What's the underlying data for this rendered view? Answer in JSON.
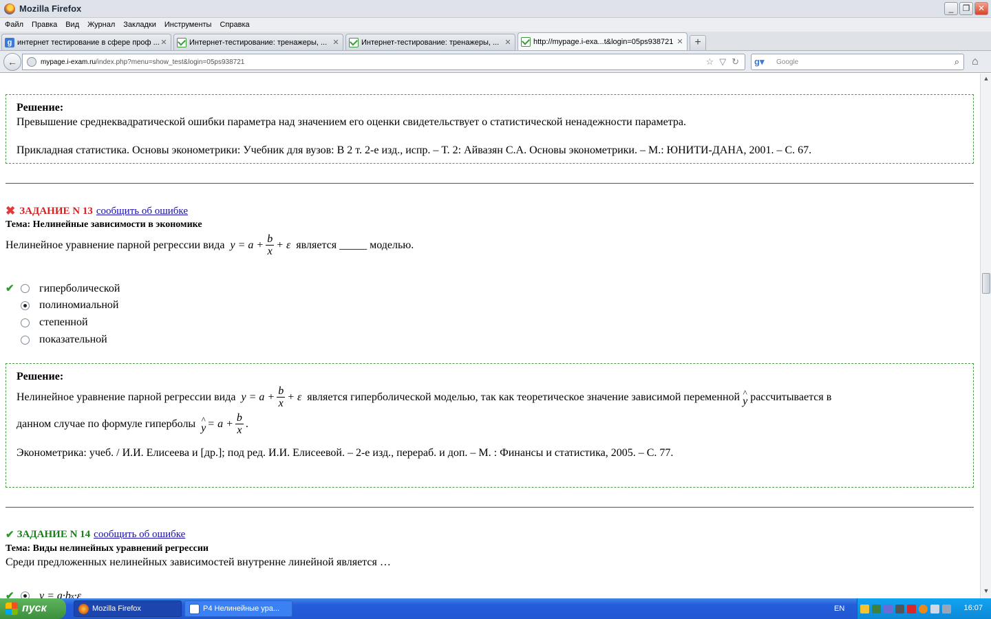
{
  "window": {
    "title": "Mozilla Firefox"
  },
  "menu": [
    "Файл",
    "Правка",
    "Вид",
    "Журнал",
    "Закладки",
    "Инструменты",
    "Справка"
  ],
  "tabs": [
    {
      "label": "интернет тестирование в сфере проф ...",
      "icon": "google-icon"
    },
    {
      "label": "Интернет-тестирование: тренажеры, ...",
      "icon": "envelope-check-icon"
    },
    {
      "label": "Интернет-тестирование: тренажеры, ...",
      "icon": "envelope-check-icon"
    },
    {
      "label": "http://mypage.i-exa...t&login=05ps938721",
      "icon": "envelope-check-icon"
    }
  ],
  "nav": {
    "url_host": "mypage.i-exam.ru",
    "url_path": "/index.php?menu=show_test&login=05ps938721",
    "search_placeholder": "Google"
  },
  "prev_solution": {
    "heading": "Решение:",
    "text": "Превышение среднеквадратической ошибки параметра над значением его оценки свидетельствует о статистической ненадежности параметра.",
    "reference": "Прикладная статистика. Основы эконометрики: Учебник для вузов: В 2 т. 2-е изд., испр. – Т. 2: Айвазян С.А. Основы эконометрики. – М.: ЮНИТИ-ДАНА, 2001. – С. 67."
  },
  "task13": {
    "title": "ЗАДАНИЕ N 13",
    "report_link": "сообщить об ошибке",
    "topic": "Тема: Нелинейные зависимости в экономике",
    "question_before": "Нелинейное уравнение парной регрессии вида",
    "question_after": "является _____ моделью.",
    "options": [
      {
        "label": "гиперболической",
        "selected": false,
        "correct": true
      },
      {
        "label": "полиномиальной",
        "selected": true,
        "correct": false
      },
      {
        "label": "степенной",
        "selected": false,
        "correct": false
      },
      {
        "label": "показательной",
        "selected": false,
        "correct": false
      }
    ],
    "solution": {
      "heading": "Решение:",
      "line1_before": "Нелинейное уравнение парной регрессии вида",
      "line1_after": "является гиперболической моделью, так как теоретическое значение зависимой переменной",
      "line1_end": "рассчитывается в",
      "line2": "данном случае по формуле гиперболы",
      "reference": "Эконометрика: учеб. / И.И. Елисеева и [др.]; под ред. И.И. Елисеевой. – 2-е изд., перераб. и доп. – М. : Финансы и статистика, 2005. – С. 77."
    }
  },
  "task14": {
    "title": "ЗАДАНИЕ N 14",
    "report_link": "сообщить об ошибке",
    "topic": "Тема: Виды нелинейных уравнений регрессии",
    "question": "Среди предложенных нелинейных зависимостей внутренне линейной является …"
  },
  "taskbar": {
    "start": "пуск",
    "items": [
      "Mozilla Firefox",
      "P4 Нелинейные ура..."
    ],
    "lang": "EN",
    "clock": "16:07"
  }
}
